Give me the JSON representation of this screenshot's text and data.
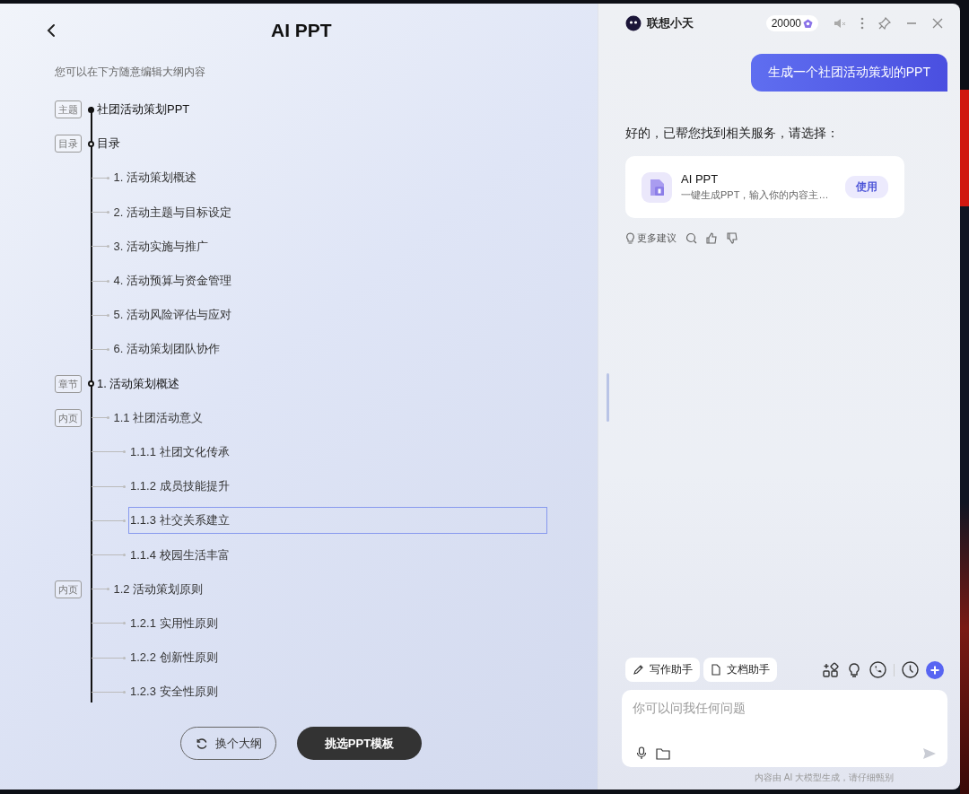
{
  "outline_panel": {
    "title": "AI PPT",
    "hint": "您可以在下方随意编辑大纲内容",
    "items": [
      {
        "tag": "主题",
        "text": "社团活动策划PPT",
        "kind": "topic",
        "selected": false
      },
      {
        "tag": "目录",
        "text": "目录",
        "kind": "toc",
        "selected": false,
        "children": [
          {
            "text": "1. 活动策划概述",
            "selected": false
          },
          {
            "text": "2. 活动主题与目标设定",
            "selected": false
          },
          {
            "text": "3. 活动实施与推广",
            "selected": false
          },
          {
            "text": "4. 活动预算与资金管理",
            "selected": false
          },
          {
            "text": "5. 活动风险评估与应对",
            "selected": false
          },
          {
            "text": "6. 活动策划团队协作",
            "selected": false
          }
        ]
      },
      {
        "tag": "章节",
        "text": "1. 活动策划概述",
        "kind": "chapter",
        "selected": false,
        "children": [
          {
            "tag": "内页",
            "text": "1.1 社团活动意义",
            "selected": false,
            "children": [
              {
                "text": "1.1.1 社团文化传承",
                "selected": false
              },
              {
                "text": "1.1.2 成员技能提升",
                "selected": false
              },
              {
                "text": "1.1.3 社交关系建立",
                "selected": true
              },
              {
                "text": "1.1.4 校园生活丰富",
                "selected": false
              }
            ]
          },
          {
            "tag": "内页",
            "text": "1.2 活动策划原则",
            "selected": false,
            "children": [
              {
                "text": "1.2.1 实用性原则",
                "selected": false
              },
              {
                "text": "1.2.2 创新性原则",
                "selected": false
              },
              {
                "text": "1.2.3 安全性原则",
                "selected": false
              }
            ]
          }
        ]
      }
    ],
    "buttons": [
      {
        "label": "换个大纲",
        "kind": "secondary"
      },
      {
        "label": "挑选PPT模板",
        "kind": "primary"
      }
    ]
  },
  "assistant": {
    "name": "联想小天",
    "credits": "20000",
    "messages": [
      {
        "kind": "user",
        "text": "生成一个社团活动策划的PPT"
      },
      {
        "kind": "assistant",
        "text": "好的，已帮您找到相关服务，请选择："
      }
    ],
    "service_card": {
      "title": "AI PPT",
      "description": "一键生成PPT，输入你的内容主…",
      "action": "使用"
    },
    "more_suggestions": "更多建议",
    "tools": [
      "写作助手",
      "文档助手"
    ],
    "input": {
      "placeholder": "你可以问我任何问题"
    },
    "disclaimer": "内容由 AI 大模型生成，请仔细甄别"
  }
}
